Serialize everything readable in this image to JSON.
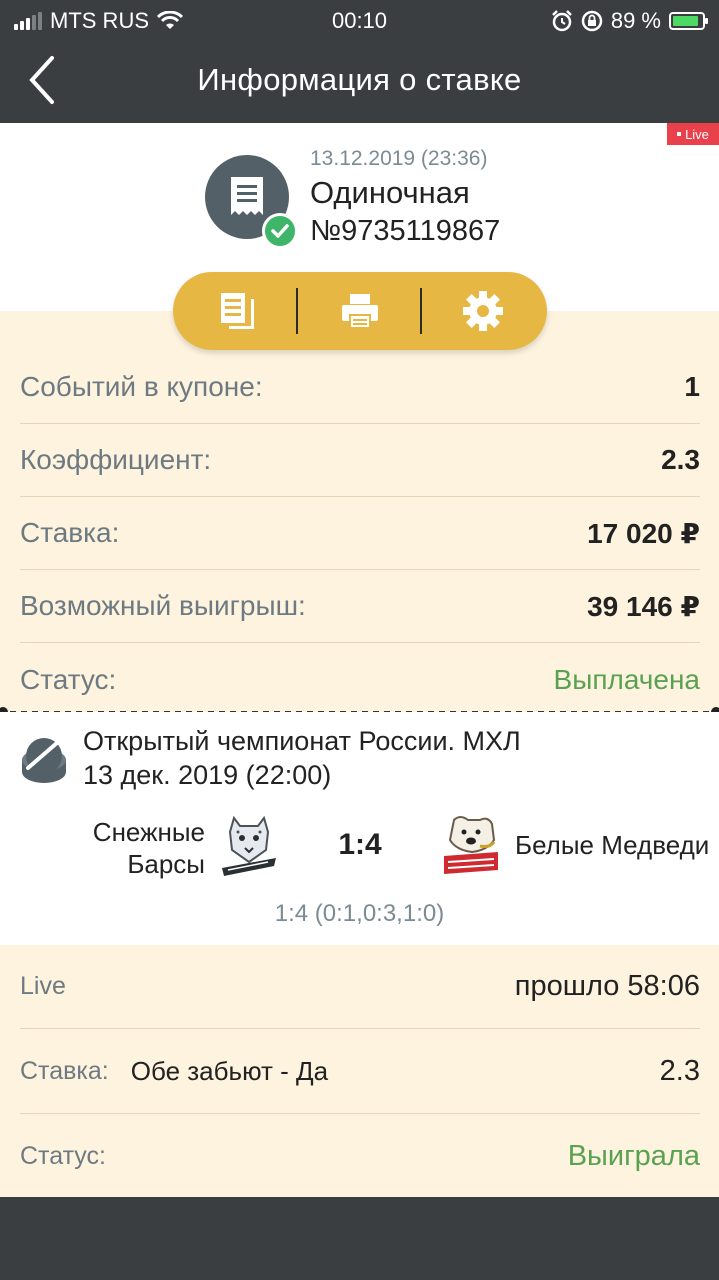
{
  "status_bar": {
    "carrier": "MTS RUS",
    "time": "00:10",
    "battery": "89 %",
    "battery_level": 0.89
  },
  "nav": {
    "title": "Информация о ставке"
  },
  "bet": {
    "live_badge": "Live",
    "date": "13.12.2019 (23:36)",
    "type": "Одиночная",
    "number": "№9735119867"
  },
  "summary": {
    "rows": [
      {
        "label": "Событий в купоне:",
        "value": "1"
      },
      {
        "label": "Коэффициент:",
        "value": "2.3"
      },
      {
        "label": "Ставка:",
        "value": "17 020 ₽"
      },
      {
        "label": "Возможный выигрыш:",
        "value": "39 146 ₽"
      },
      {
        "label": "Статус:",
        "value": "Выплачена"
      }
    ]
  },
  "event": {
    "tournament": "Открытый чемпионат России. МХЛ",
    "date": "13 дек. 2019 (22:00)",
    "home_team_line1": "Снежные",
    "home_team_line2": "Барсы",
    "away_team": "Белые Медведи",
    "score": "1:4",
    "score_detail": "1:4 (0:1,0:3,1:0)"
  },
  "detail": {
    "live_label": "Live",
    "live_value": "прошло 58:06",
    "stake_label": "Ставка:",
    "selection": "Обе забьют - Да",
    "odds": "2.3",
    "status_label": "Статус:",
    "status_value": "Выиграла"
  },
  "colors": {
    "header_bg": "#3a3e40",
    "accent_yellow": "#e7b744",
    "cream": "#fdf3de",
    "status_green": "#5aa252",
    "live_red": "#e8414b"
  },
  "icons": [
    "back-chevron-icon",
    "wifi-icon",
    "alarm-icon",
    "rotation-lock-icon",
    "battery-icon",
    "receipt-icon",
    "check-icon",
    "copy-document-icon",
    "print-icon",
    "gear-icon",
    "hockey-puck-icon"
  ]
}
